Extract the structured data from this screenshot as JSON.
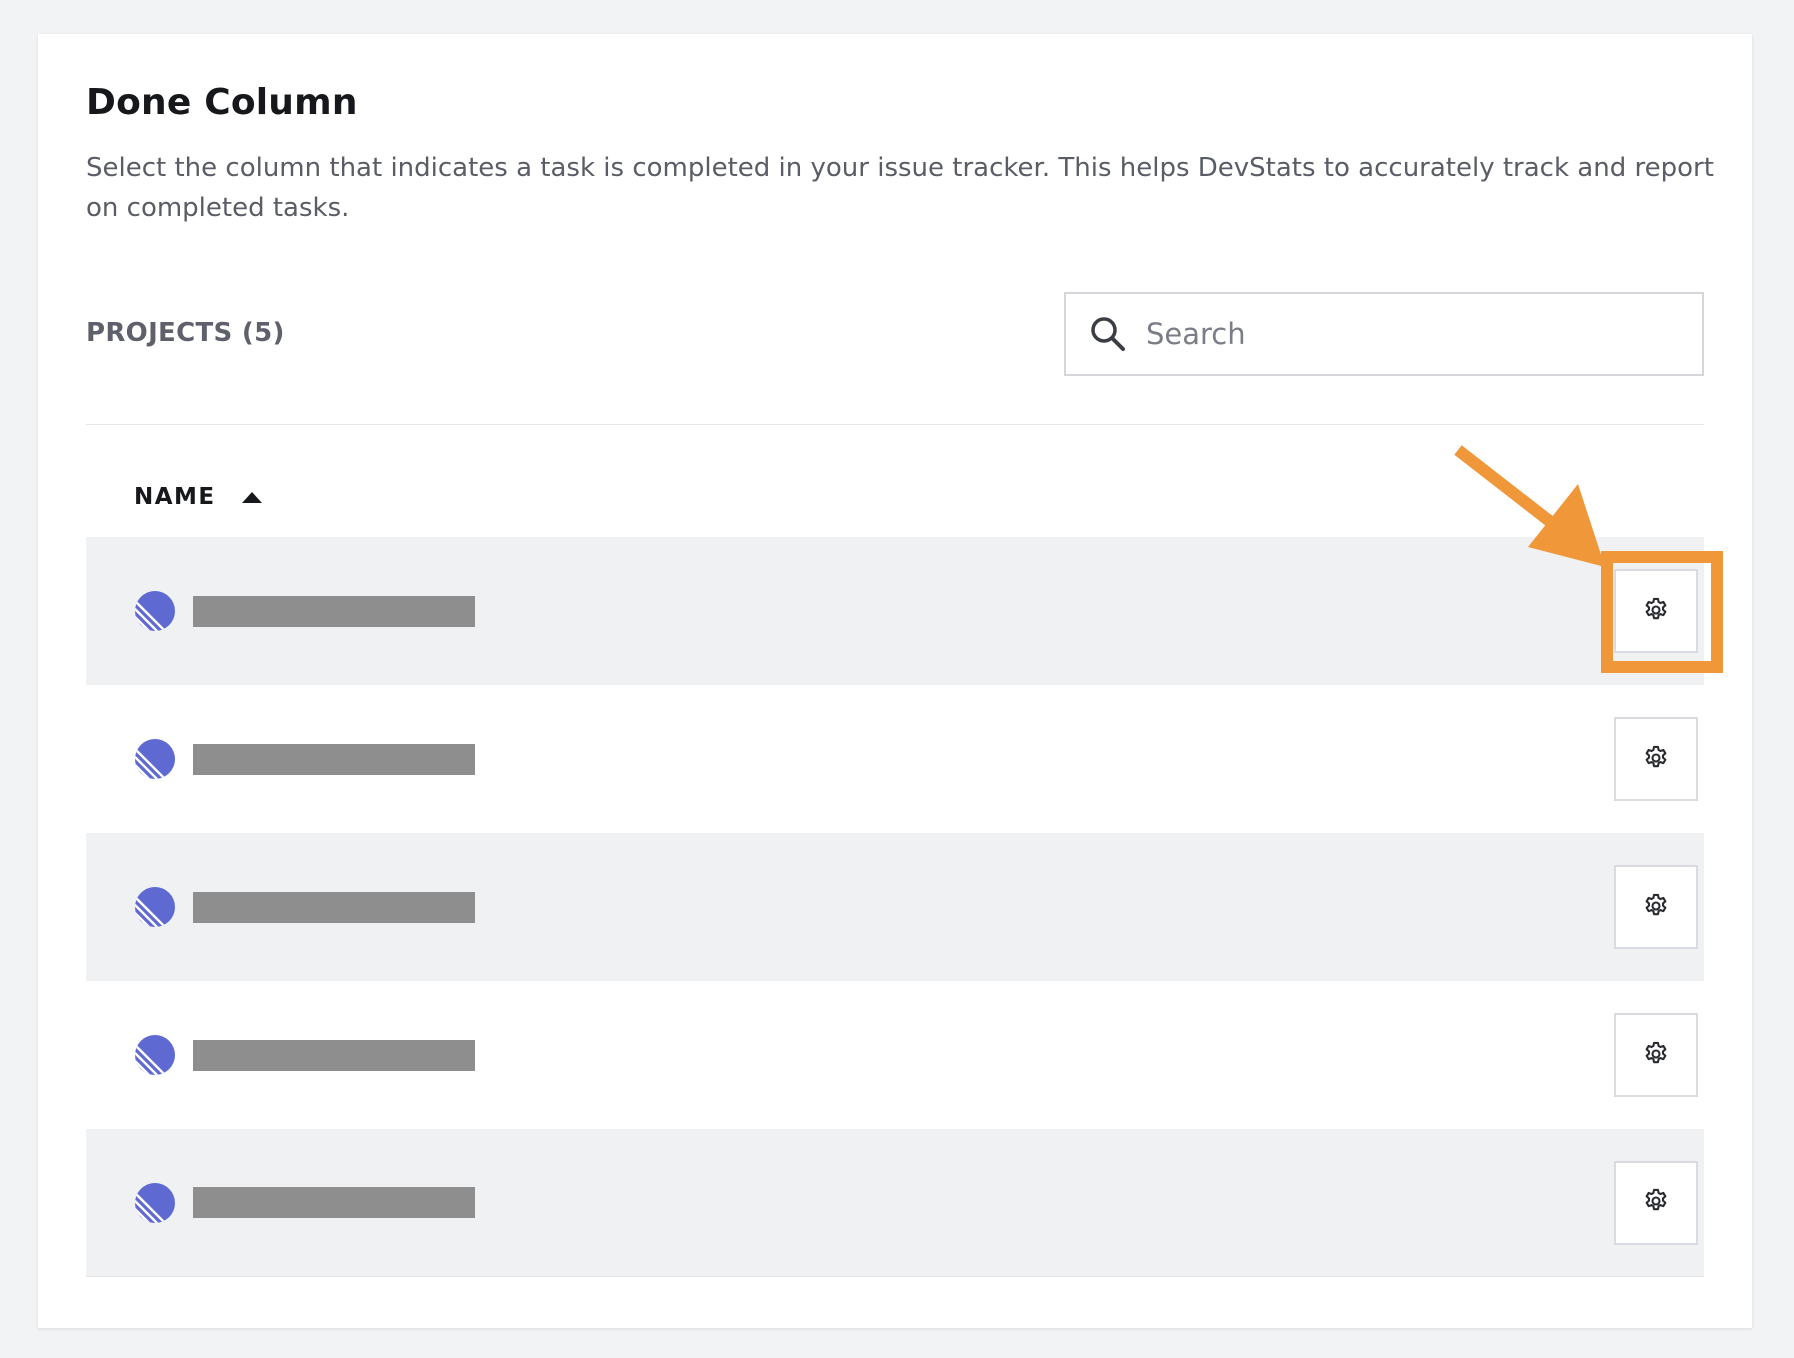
{
  "page": {
    "title": "Done Column",
    "description": "Select the column that indicates a task is completed in your issue tracker. This helps DevStats to accurately track and report on completed tasks."
  },
  "projects": {
    "count_label": "PROJECTS (5)"
  },
  "search": {
    "placeholder": "Search",
    "value": ""
  },
  "table": {
    "column_name_header": "NAME",
    "sort_direction": "ascending",
    "rows": [
      {
        "name": "",
        "name_redacted": true,
        "icon": "linear-logo-icon",
        "settings_icon": "gear-icon",
        "highlighted": true
      },
      {
        "name": "",
        "name_redacted": true,
        "icon": "linear-logo-icon",
        "settings_icon": "gear-icon",
        "highlighted": false
      },
      {
        "name": "",
        "name_redacted": true,
        "icon": "linear-logo-icon",
        "settings_icon": "gear-icon",
        "highlighted": false
      },
      {
        "name": "",
        "name_redacted": true,
        "icon": "linear-logo-icon",
        "settings_icon": "gear-icon",
        "highlighted": false
      },
      {
        "name": "",
        "name_redacted": true,
        "icon": "linear-logo-icon",
        "settings_icon": "gear-icon",
        "highlighted": false
      }
    ]
  },
  "colors": {
    "highlight": "#f0973a",
    "linear_logo": "#5e6ad2",
    "redaction": "#8e8e8e",
    "row_shade": "#f0f1f3",
    "page_background": "#f2f3f5"
  }
}
